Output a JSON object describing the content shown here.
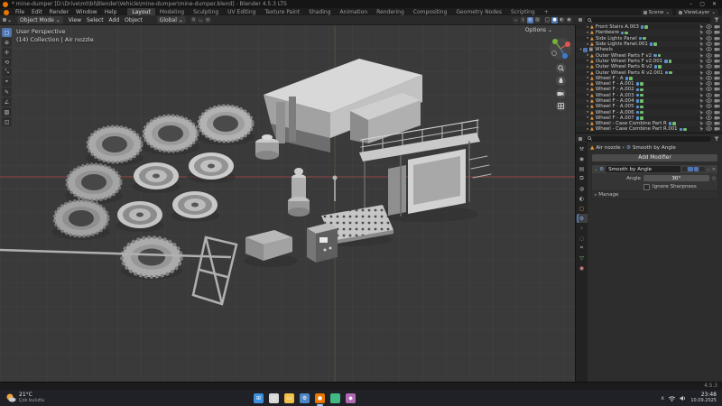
{
  "window": {
    "title": "* mine-dumper [D:\\Drive\\mt\\bl\\Blender\\Vehicle\\mine-dumper\\mine-dumper.blend] - Blender 4.5.3 LTS",
    "minimize": "–",
    "maximize": "▢",
    "close": "✕"
  },
  "topbar": {
    "menus": [
      {
        "label": "File"
      },
      {
        "label": "Edit"
      },
      {
        "label": "Render"
      },
      {
        "label": "Window"
      },
      {
        "label": "Help"
      }
    ],
    "tabs": [
      {
        "label": "Layout",
        "active": true
      },
      {
        "label": "Modeling"
      },
      {
        "label": "Sculpting"
      },
      {
        "label": "UV Editing"
      },
      {
        "label": "Texture Paint"
      },
      {
        "label": "Shading"
      },
      {
        "label": "Animation"
      },
      {
        "label": "Rendering"
      },
      {
        "label": "Compositing"
      },
      {
        "label": "Geometry Nodes"
      },
      {
        "label": "Scripting"
      },
      {
        "label": "+"
      }
    ],
    "scene_label": "Scene",
    "viewlayer_label": "ViewLayer"
  },
  "viewport_header": {
    "mode": "Object Mode",
    "menus": [
      {
        "label": "View"
      },
      {
        "label": "Select"
      },
      {
        "label": "Add"
      },
      {
        "label": "Object"
      }
    ],
    "orientation": "Global",
    "options_label": "Options",
    "dropdown_glyph": "⌄"
  },
  "viewport": {
    "overlay_line1": "User Perspective",
    "overlay_line2": "(14) Collection | Air nozzle",
    "axis_x_color": "#8a4444",
    "axis_y_color": "#5a7a4a",
    "bg_color": "#3a3a3a",
    "grid_color": "#434343"
  },
  "toolbar": {
    "tools": [
      {
        "name": "select-box",
        "glyph": "▢",
        "active": true
      },
      {
        "name": "cursor",
        "glyph": "⊕"
      },
      {
        "name": "move",
        "glyph": "✢"
      },
      {
        "name": "rotate",
        "glyph": "⟲"
      },
      {
        "name": "scale",
        "glyph": "⤡"
      },
      {
        "name": "transform",
        "glyph": "⌖"
      },
      {
        "name": "annotate",
        "glyph": "✎"
      },
      {
        "name": "measure",
        "glyph": "∠"
      },
      {
        "name": "add-cube",
        "glyph": "▧"
      },
      {
        "name": "extrude",
        "glyph": "◫"
      }
    ]
  },
  "outliner": {
    "rows": [
      {
        "tri": "▸",
        "glyph": "▲",
        "color": "#e0933f",
        "name": "Front Stairs A.003",
        "depth": 1,
        "mods": true
      },
      {
        "tri": "▸",
        "glyph": "▲",
        "color": "#e0933f",
        "name": "Hardware",
        "depth": 1,
        "mods": true
      },
      {
        "tri": "▸",
        "glyph": "▲",
        "color": "#e0933f",
        "name": "Side Lights Panel",
        "depth": 1,
        "mods": true
      },
      {
        "tri": "▸",
        "glyph": "▲",
        "color": "#e0933f",
        "name": "Side Lights Panel.001",
        "depth": 1,
        "mods": true
      },
      {
        "tri": "▾",
        "glyph": "▦",
        "color": "#cccccc",
        "name": "Wheels",
        "depth": 0,
        "check": true
      },
      {
        "tri": "▸",
        "glyph": "▲",
        "color": "#e0933f",
        "name": "Outer Wheel Parts F v2",
        "depth": 1,
        "mods": true
      },
      {
        "tri": "▸",
        "glyph": "▲",
        "color": "#e0933f",
        "name": "Outer Wheel Parts F v2.001",
        "depth": 1,
        "mods": true
      },
      {
        "tri": "▸",
        "glyph": "▲",
        "color": "#e0933f",
        "name": "Outer Wheel Parts R v2",
        "depth": 1,
        "mods": true
      },
      {
        "tri": "▸",
        "glyph": "▲",
        "color": "#e0933f",
        "name": "Outer Wheel Parts R v2.001",
        "depth": 1,
        "mods": true
      },
      {
        "tri": "▸",
        "glyph": "▲",
        "color": "#e0933f",
        "name": "Wheel F - A",
        "depth": 1,
        "mods": true
      },
      {
        "tri": "▸",
        "glyph": "▲",
        "color": "#e0933f",
        "name": "Wheel F - A.001",
        "depth": 1,
        "mods": true
      },
      {
        "tri": "▸",
        "glyph": "▲",
        "color": "#e0933f",
        "name": "Wheel F - A.002",
        "depth": 1,
        "mods": true
      },
      {
        "tri": "▸",
        "glyph": "▲",
        "color": "#e0933f",
        "name": "Wheel F - A.003",
        "depth": 1,
        "mods": true
      },
      {
        "tri": "▸",
        "glyph": "▲",
        "color": "#e0933f",
        "name": "Wheel F - A.004",
        "depth": 1,
        "mods": true
      },
      {
        "tri": "▸",
        "glyph": "▲",
        "color": "#e0933f",
        "name": "Wheel F - A.005",
        "depth": 1,
        "mods": true
      },
      {
        "tri": "▸",
        "glyph": "▲",
        "color": "#e0933f",
        "name": "Wheel F - A.006",
        "depth": 1,
        "mods": true
      },
      {
        "tri": "▸",
        "glyph": "▲",
        "color": "#e0933f",
        "name": "Wheel F - A.007",
        "depth": 1,
        "mods": true
      },
      {
        "tri": "▸",
        "glyph": "▲",
        "color": "#e0933f",
        "name": "Wheel - Case Combine Part R",
        "depth": 1,
        "mods": true
      },
      {
        "tri": "▸",
        "glyph": "▲",
        "color": "#e0933f",
        "name": "Wheel - Case Combine Part R.001",
        "depth": 1,
        "mods": true
      }
    ]
  },
  "properties": {
    "tabs": [
      {
        "name": "tool",
        "glyph": "⚒",
        "color": "#a5a5a5"
      },
      {
        "name": "render",
        "glyph": "◉",
        "color": "#a5a5a5"
      },
      {
        "name": "output",
        "glyph": "▤",
        "color": "#a5a5a5"
      },
      {
        "name": "view-layer",
        "glyph": "⧉",
        "color": "#a5a5a5"
      },
      {
        "name": "scene",
        "glyph": "◍",
        "color": "#a5a5a5"
      },
      {
        "name": "world",
        "glyph": "◐",
        "color": "#a5a5a5"
      },
      {
        "name": "object",
        "glyph": "▢",
        "color": "#e0933f"
      },
      {
        "name": "modifiers",
        "glyph": "⚙",
        "color": "#7db1e8",
        "active": true
      },
      {
        "name": "particles",
        "glyph": "⁘",
        "color": "#a5a5a5"
      },
      {
        "name": "physics",
        "glyph": "◌",
        "color": "#77b3e0"
      },
      {
        "name": "constraints",
        "glyph": "⌗",
        "color": "#a5a5a5"
      },
      {
        "name": "object-data",
        "glyph": "▽",
        "color": "#7ec77e"
      },
      {
        "name": "material",
        "glyph": "◉",
        "color": "#d98c8c"
      }
    ],
    "breadcrumb_object": "Air nozzle",
    "breadcrumb_modifier": "Smooth by Angle",
    "breadcrumb_sep": "›",
    "add_modifier_label": "Add Modifier",
    "modifier": {
      "name": "Smooth by Angle",
      "angle_label": "Angle",
      "angle_value": "30°",
      "checkbox_label": "Ignore Sharpness",
      "manage_label": "Manage",
      "close_glyph": "✕",
      "collapse_glyph": "⌄",
      "expand_glyph": "▸"
    }
  },
  "statusbar": {
    "version": "4.5.3"
  },
  "taskbar": {
    "weather": {
      "temp": "21°C",
      "condition": "Çok bulutlu"
    },
    "icons": [
      {
        "name": "start",
        "color": "#3d8fe0",
        "glyph": "⊞",
        "active": false
      },
      {
        "name": "search",
        "color": "#d8d8d8",
        "glyph": "○",
        "active": false
      },
      {
        "name": "file-explorer",
        "color": "#f0c14b",
        "glyph": "▭",
        "active": false
      },
      {
        "name": "settings",
        "color": "#4f86c6",
        "glyph": "⚙",
        "active": false
      },
      {
        "name": "blender",
        "color": "#ea7600",
        "glyph": "●",
        "active": true
      },
      {
        "name": "app-green",
        "color": "#41b883",
        "glyph": "",
        "active": false
      },
      {
        "name": "app-purple",
        "color": "#b06ab3",
        "glyph": "◆",
        "active": false
      }
    ],
    "tray_chevron": "∧",
    "time": "23:48",
    "date": "10.09.2025"
  }
}
